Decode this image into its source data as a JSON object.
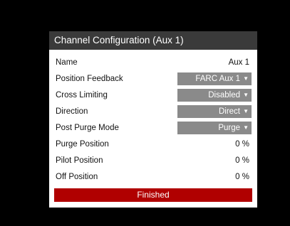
{
  "dialog": {
    "title": "Channel Configuration  (Aux 1)"
  },
  "rows": [
    {
      "label": "Name",
      "value": "Aux 1",
      "type": "text"
    },
    {
      "label": "Position Feedback",
      "value": "FARC Aux 1",
      "type": "dropdown"
    },
    {
      "label": "Cross Limiting",
      "value": "Disabled",
      "type": "dropdown"
    },
    {
      "label": "Direction",
      "value": "Direct",
      "type": "dropdown"
    },
    {
      "label": "Post Purge Mode",
      "value": "Purge",
      "type": "dropdown"
    },
    {
      "label": "Purge Position",
      "value": "0 %",
      "type": "text"
    },
    {
      "label": "Pilot Position",
      "value": "0 %",
      "type": "text"
    },
    {
      "label": "Off Position",
      "value": "0 %",
      "type": "text"
    }
  ],
  "icons": {
    "dropdown_arrow": "triangle-down-icon"
  },
  "footer": {
    "finished_label": "Finished"
  },
  "colors": {
    "background": "#000000",
    "titlebar": "#3a3a3a",
    "dropdown": "#8a8a8a",
    "finished_button": "#b00000"
  }
}
